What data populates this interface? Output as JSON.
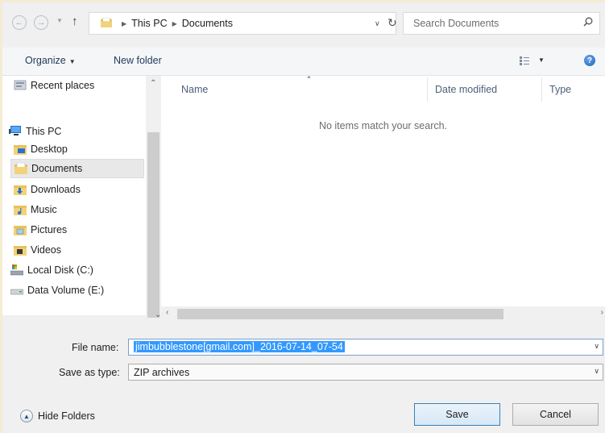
{
  "address": {
    "crumbs": [
      "This PC",
      "Documents"
    ],
    "search_placeholder": "Search Documents"
  },
  "toolbar": {
    "organize_label": "Organize",
    "new_folder_label": "New folder"
  },
  "nav": {
    "items": [
      {
        "label": "Recent places",
        "icon": "recent-places-icon"
      },
      {
        "label": "This PC",
        "icon": "computer-icon"
      },
      {
        "label": "Desktop",
        "icon": "desktop-folder-icon"
      },
      {
        "label": "Documents",
        "icon": "documents-folder-icon",
        "selected": true
      },
      {
        "label": "Downloads",
        "icon": "downloads-folder-icon"
      },
      {
        "label": "Music",
        "icon": "music-folder-icon"
      },
      {
        "label": "Pictures",
        "icon": "pictures-folder-icon"
      },
      {
        "label": "Videos",
        "icon": "videos-folder-icon"
      },
      {
        "label": "Local Disk (C:)",
        "icon": "local-disk-icon"
      },
      {
        "label": "Data Volume (E:)",
        "icon": "drive-icon"
      }
    ]
  },
  "filelist": {
    "columns": [
      "Name",
      "Date modified",
      "Type"
    ],
    "empty_message": "No items match your search."
  },
  "form": {
    "file_name_label": "File name:",
    "file_name_value": "jimbubblestone[gmail.com]_2016-07-14_07-54",
    "save_type_label": "Save as type:",
    "save_type_value": "ZIP archives",
    "hide_folders_label": "Hide Folders",
    "save_label": "Save",
    "cancel_label": "Cancel"
  },
  "colors": {
    "background_frame": "#f4ecd3",
    "selection_blue": "#3399ff",
    "link_text": "#1e395b"
  }
}
